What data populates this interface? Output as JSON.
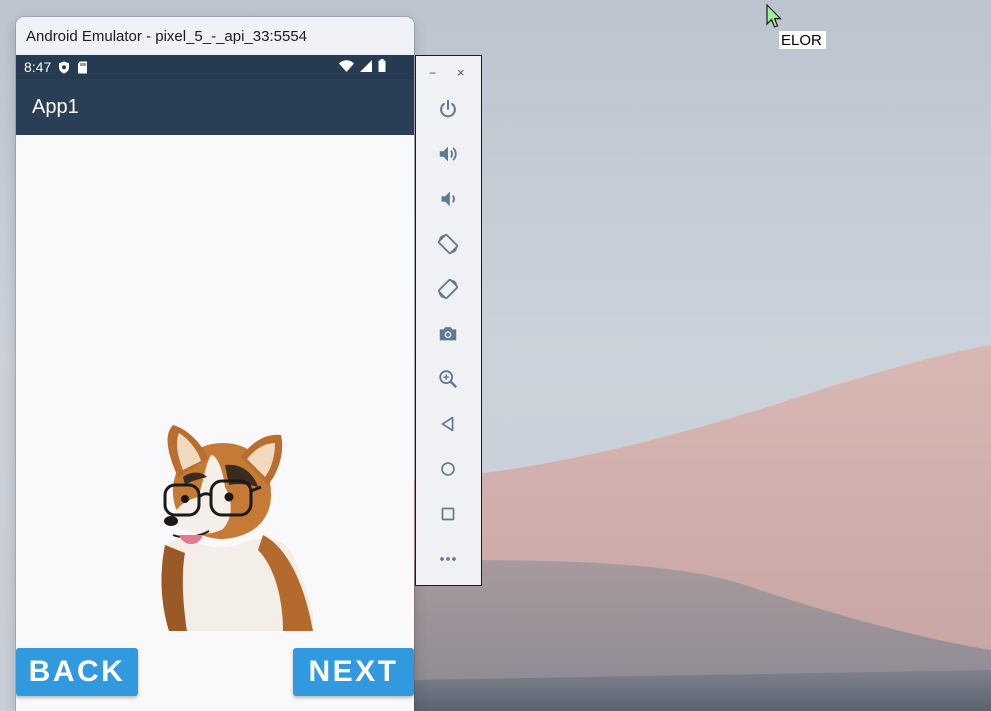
{
  "desktop": {
    "tooltip_text": "ELOR"
  },
  "window": {
    "title": "Android Emulator - pixel_5_-_api_33:5554"
  },
  "statusbar": {
    "time": "8:47"
  },
  "app": {
    "title": "App1",
    "back_label": "BACK",
    "next_label": "NEXT",
    "image_icon": "dog-with-glasses-image"
  },
  "toolbar": {
    "minimize_label": "−",
    "close_label": "×",
    "items": [
      {
        "icon": "power-icon"
      },
      {
        "icon": "volume-up-icon"
      },
      {
        "icon": "volume-down-icon"
      },
      {
        "icon": "rotate-left-icon"
      },
      {
        "icon": "rotate-right-icon"
      },
      {
        "icon": "camera-icon"
      },
      {
        "icon": "zoom-icon"
      },
      {
        "icon": "back-triangle-icon"
      },
      {
        "icon": "home-circle-icon"
      },
      {
        "icon": "overview-square-icon"
      },
      {
        "icon": "more-icon"
      }
    ]
  },
  "colors": {
    "appbar": "#2a3f55",
    "statusbar": "#263a51",
    "button": "#3199dd",
    "toolbar_icon": "#5f7a8e"
  }
}
